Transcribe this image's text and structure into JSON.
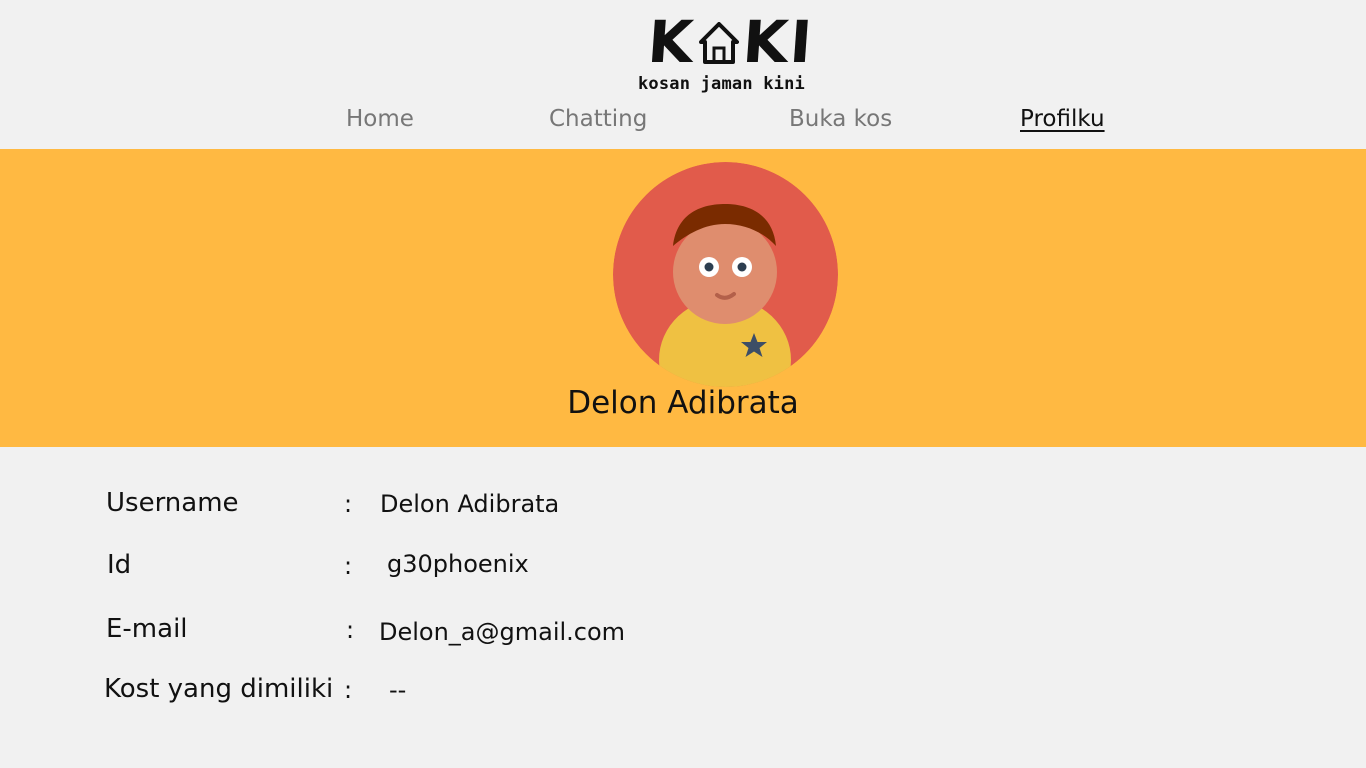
{
  "brand": {
    "logo_text": "KAKI",
    "tagline": "kosan jaman kini"
  },
  "nav": {
    "items": [
      {
        "label": "Home",
        "active": false
      },
      {
        "label": "Chatting",
        "active": false
      },
      {
        "label": "Buka kos",
        "active": false
      },
      {
        "label": "Profilku",
        "active": true
      }
    ]
  },
  "profile": {
    "name": "Delon Adibrata",
    "avatar_icon": "user-avatar-icon",
    "banner_color": "#ffb942",
    "fields": [
      {
        "label": "Username",
        "separator": ":",
        "value": "Delon Adibrata"
      },
      {
        "label": "Id",
        "separator": ":",
        "value": "g30phoenix"
      },
      {
        "label": "E-mail",
        "separator": ":",
        "value": "Delon_a@gmail.com"
      },
      {
        "label": "Kost yang dimiliki",
        "separator": ":",
        "value": "--"
      }
    ]
  }
}
